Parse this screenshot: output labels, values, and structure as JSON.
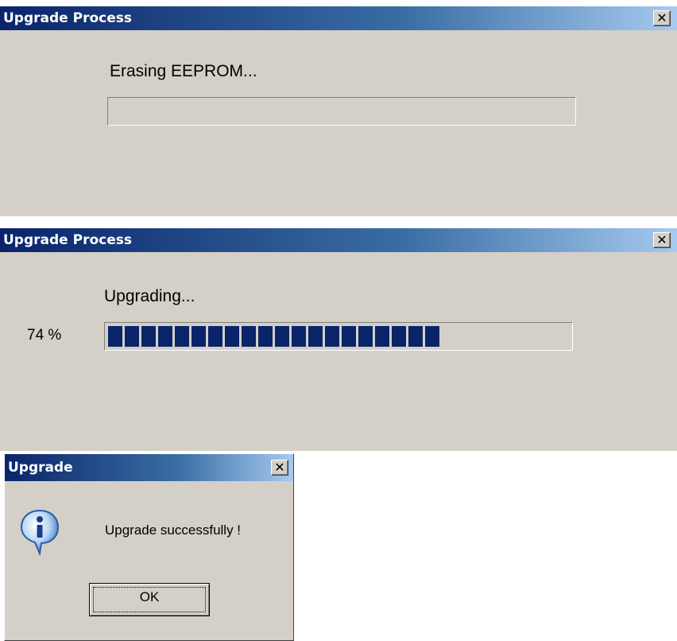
{
  "dialog_erase": {
    "title": "Upgrade Process",
    "close_glyph": "✕",
    "message": "Erasing EEPROM...",
    "progress": 0
  },
  "dialog_upgrade": {
    "title": "Upgrade Process",
    "close_glyph": "✕",
    "message": "Upgrading...",
    "percent_label": "74 %",
    "progress": 0.74
  },
  "dialog_done": {
    "title": "Upgrade",
    "close_glyph": "✕",
    "message": "Upgrade successfully !",
    "icon": "info-icon",
    "ok_label": "OK"
  },
  "colors": {
    "titlebar_start": "#0a246a",
    "titlebar_end": "#a6caf0",
    "dialog_bg": "#d4d0c8",
    "progress_fill": "#0a246a"
  }
}
